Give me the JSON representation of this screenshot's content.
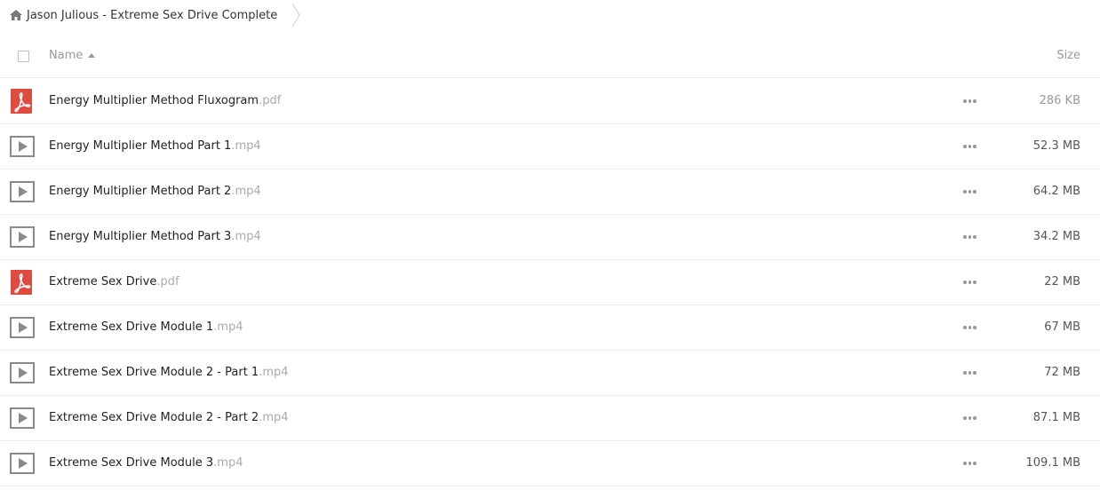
{
  "breadcrumb": {
    "home_icon": "home-icon",
    "label": "Jason Julious - Extreme Sex Drive Complete"
  },
  "header": {
    "name_label": "Name",
    "size_label": "Size",
    "sort": "ascending"
  },
  "colors": {
    "pdf_red": "#e04b3f",
    "video_gray": "#8a8a8a",
    "divider": "#ededed"
  },
  "files": [
    {
      "name": "Energy Multiplier Method Fluxogram",
      "ext": ".pdf",
      "size": "286 KB",
      "type": "pdf",
      "icon": "pdf-icon"
    },
    {
      "name": "Energy Multiplier Method Part 1",
      "ext": ".mp4",
      "size": "52.3 MB",
      "type": "video",
      "icon": "video-icon"
    },
    {
      "name": "Energy Multiplier Method Part 2",
      "ext": ".mp4",
      "size": "64.2 MB",
      "type": "video",
      "icon": "video-icon"
    },
    {
      "name": "Energy Multiplier Method Part 3",
      "ext": ".mp4",
      "size": "34.2 MB",
      "type": "video",
      "icon": "video-icon"
    },
    {
      "name": "Extreme Sex Drive",
      "ext": ".pdf",
      "size": "22 MB",
      "type": "pdf",
      "icon": "pdf-icon"
    },
    {
      "name": "Extreme Sex Drive Module 1",
      "ext": ".mp4",
      "size": "67 MB",
      "type": "video",
      "icon": "video-icon"
    },
    {
      "name": "Extreme Sex Drive Module 2 - Part 1",
      "ext": ".mp4",
      "size": "72 MB",
      "type": "video",
      "icon": "video-icon"
    },
    {
      "name": "Extreme Sex Drive Module 2 - Part 2",
      "ext": ".mp4",
      "size": "87.1 MB",
      "type": "video",
      "icon": "video-icon"
    },
    {
      "name": "Extreme Sex Drive Module 3",
      "ext": ".mp4",
      "size": "109.1 MB",
      "type": "video",
      "icon": "video-icon"
    }
  ]
}
